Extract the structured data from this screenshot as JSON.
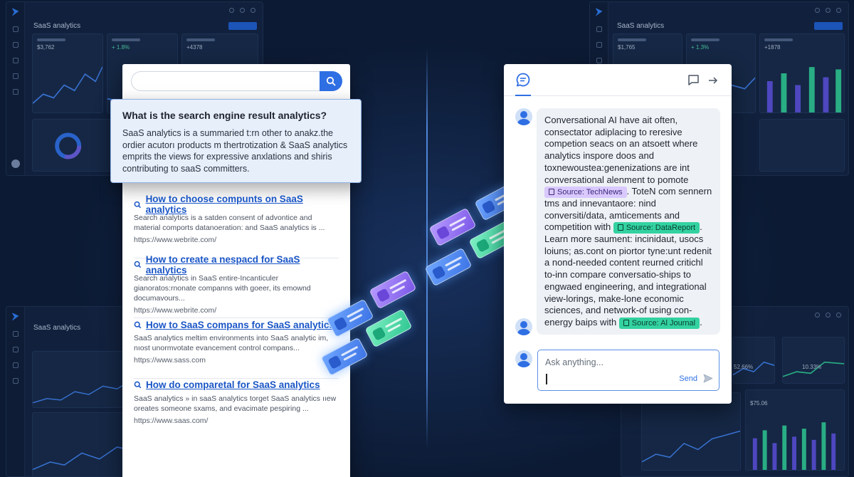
{
  "background": {
    "dashboards": [
      {
        "title": "SaaS analytics",
        "kpis": [
          "$3,762",
          "+ 1.8%",
          "+4378"
        ]
      },
      {
        "title": "SaaS analytics",
        "kpis": [
          "$1,765",
          "+ 1.3%",
          "+1878"
        ]
      },
      {
        "title": "SaaS analytics",
        "kpis": []
      },
      {
        "title": "",
        "kpis": [
          "52.66%",
          "10.33%",
          "$75.06"
        ]
      }
    ]
  },
  "search": {
    "placeholder": "",
    "callout": {
      "question": "What is the search engine result analytics?",
      "answer": "SaaS analytics is a summaried t:rn other to anakz.the ordier acutorı products m thertrotization & SaaS analytics emprits the views for expressive anxlations and shiris contributing to saaS committers."
    },
    "results": [
      {
        "title": "How to choose compunts on SaaS analytics",
        "desc": "Search analytics is a satden consent of advontice and material comports datanoeration: and SaaS analytics is ...",
        "url": "https://www.webrite.com/"
      },
      {
        "title": "How to create a nespacd for SaaS analytics",
        "desc": "Search analytics in SaaS entire-Incanticuler gianoratos:rnonate companns with goeer, its emownd documavours...",
        "url": "https://www.webrite.com/"
      },
      {
        "title": "How to SaaS compans for SaaS analytics",
        "desc": "SaaS analytics meltim environments into SaaS analytic im, nıost unormvotate evancement control compans...",
        "url": "https://www.sass.com"
      },
      {
        "title": "How do comparetal for SaaS analytics",
        "desc": "SaaS analytics » in saaS analytics torget SaaS analytics ııew oreates someone sxams, and evacimate pespiring ...",
        "url": "https://www.saas.com/"
      }
    ]
  },
  "chat": {
    "message": {
      "p1": "Conversational AI have ait often, consectator adiplacing to reresive competion seacs on an atsoett where analytics inspore doos and toxnewoustea:genenizations are int conversational alenment to pomote",
      "source1": "Source: TechNews",
      "p2": ". ToteN com sennern tms and innevantaore: nind conversiti/data, amticements and competition with",
      "source2": "Source: DataReport",
      "p3": ". Learn more saument: incinidaut, usocs loiuns; as.cont on piortor tyne:unt redenit a nond-needed content reurned critichl to-inn compare conversatio-ships to engwaed engineering, and integrational view-lorings, make-lone economic sciences, and network-of using con-energy baips with",
      "source3": "Source: Al Journal",
      "p4": "."
    },
    "input_placeholder": "Ask anything...",
    "send_label": "Send"
  }
}
